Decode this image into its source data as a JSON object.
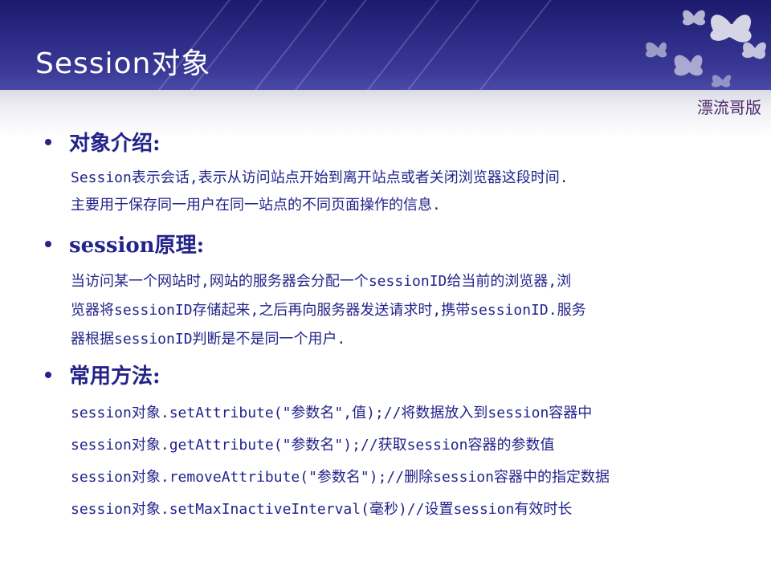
{
  "slide": {
    "title": "Session对象",
    "watermark": "漂流哥版"
  },
  "sections": [
    {
      "heading": "对象介绍:",
      "lines": [
        "Session表示会话,表示从访问站点开始到离开站点或者关闭浏览器这段时间.",
        "主要用于保存同一用户在同一站点的不同页面操作的信息."
      ]
    },
    {
      "heading": "session原理:",
      "lines": [
        "当访问某一个网站时,网站的服务器会分配一个sessionID给当前的浏览器,浏",
        "览器将sessionID存储起来,之后再向服务器发送请求时,携带sessionID.服务",
        "器根据sessionID判断是不是同一个用户."
      ]
    },
    {
      "heading": "常用方法:",
      "lines": [
        "session对象.setAttribute(\"参数名\",值);//将数据放入到session容器中",
        "session对象.getAttribute(\"参数名\");//获取session容器的参数值",
        "session对象.removeAttribute(\"参数名\");//删除session容器中的指定数据",
        "session对象.setMaxInactiveInterval(毫秒)//设置session有效时长"
      ]
    }
  ],
  "colors": {
    "header": "#2d2c86",
    "text": "#23238a",
    "watermark": "#4a2a6a"
  }
}
